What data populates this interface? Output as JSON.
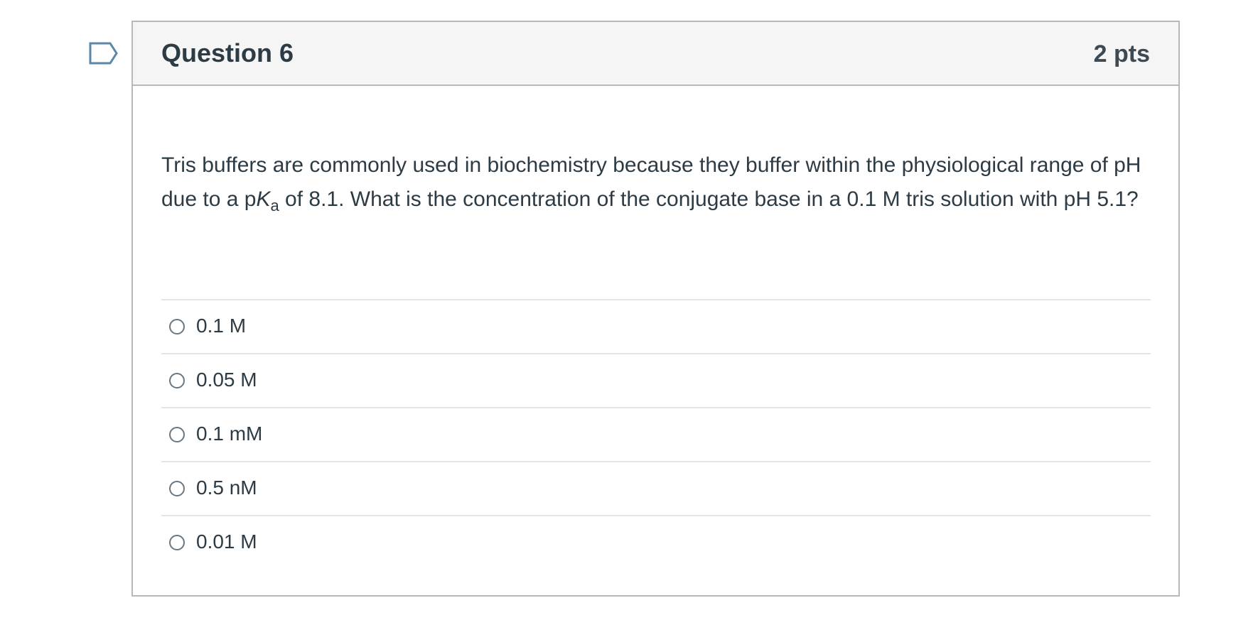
{
  "question": {
    "title": "Question 6",
    "points": "2 pts",
    "text_before": "Tris buffers are commonly used in biochemistry because they buffer within the physiological range of pH due to a p",
    "text_italic": "K",
    "text_subscript": "a",
    "text_after": " of 8.1. What is the concentration of the conjugate base in a 0.1 M tris solution with pH 5.1?"
  },
  "answers": [
    {
      "label": "0.1 M",
      "selected": false
    },
    {
      "label": "0.05 M",
      "selected": false
    },
    {
      "label": "0.1 mM",
      "selected": false
    },
    {
      "label": "0.5 nM",
      "selected": false
    },
    {
      "label": "0.01 M",
      "selected": false
    }
  ],
  "icons": {
    "flag": "bookmark-flag-icon",
    "radio": "radio-unchecked-icon"
  },
  "colors": {
    "header_bg": "#f5f5f5",
    "border": "#b5b9bc",
    "text": "#2d3b45",
    "flag": "#5b87a8"
  }
}
